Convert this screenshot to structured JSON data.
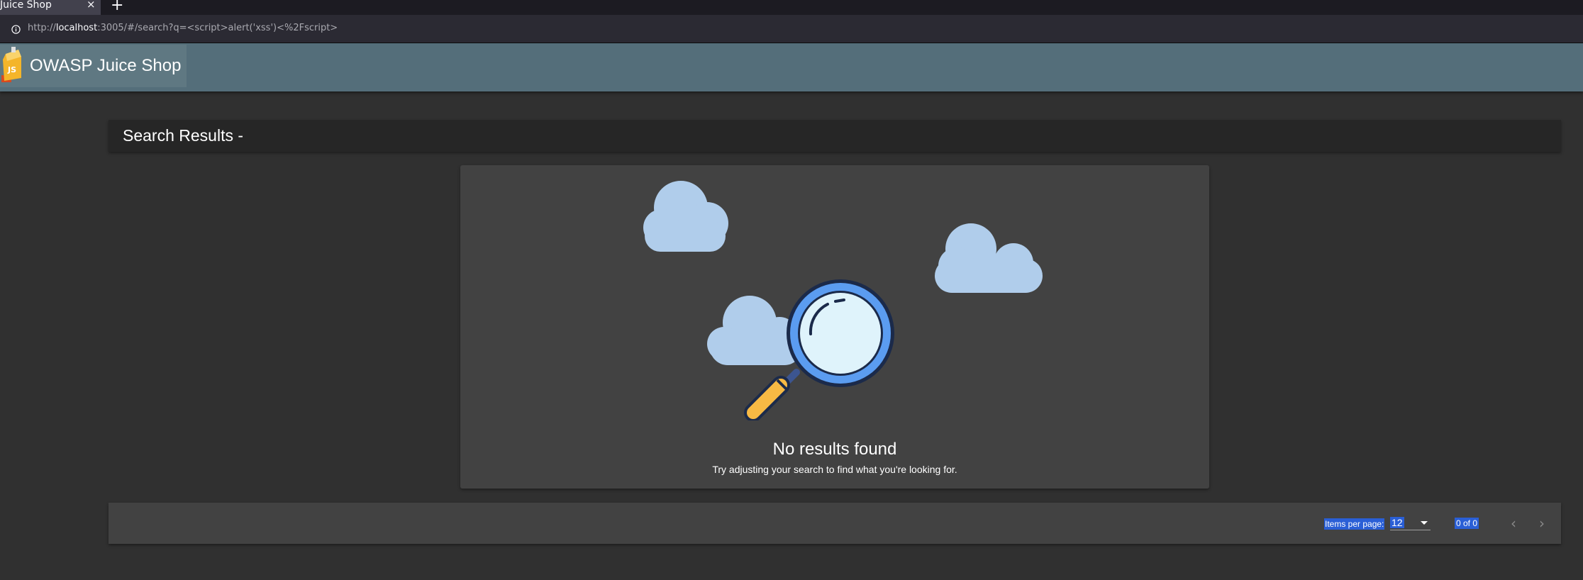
{
  "browser": {
    "tab_title": "Juice Shop",
    "tab_close": "×",
    "new_tab": "+",
    "url_prefix": "http://",
    "url_host": "localhost",
    "url_rest": ":3005/#/search?q=<script>alert('xss')<%2Fscript>"
  },
  "app": {
    "name": "OWASP Juice Shop",
    "toolbar_color": "#546e7a"
  },
  "search": {
    "title": "Search Results - "
  },
  "empty_state": {
    "title": "No results found",
    "hint": "Try adjusting your search to find what you're looking for.",
    "icon": "magnifier-with-clouds-icon"
  },
  "paginator": {
    "items_per_page_label": "Items per page:",
    "page_size": "12",
    "range_label": "0 of 0",
    "prev_icon": "‹",
    "next_icon": "›"
  },
  "colors": {
    "background": "#303030",
    "card": "#424242",
    "selection_highlight": "#2a5fd6",
    "cloud": "#b0cdeb"
  }
}
